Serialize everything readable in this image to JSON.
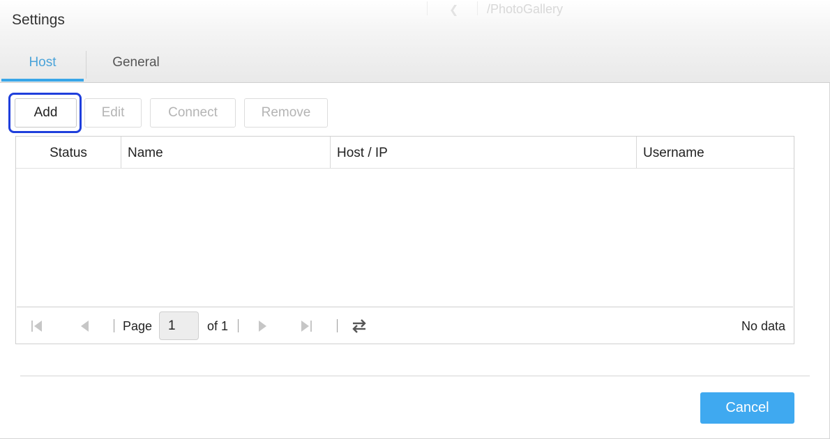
{
  "background": {
    "breadcrumb_path": "/PhotoGallery"
  },
  "dialog": {
    "title": "Settings"
  },
  "tabs": [
    {
      "label": "Host",
      "active": true
    },
    {
      "label": "General",
      "active": false
    }
  ],
  "toolbar": {
    "add_label": "Add",
    "edit_label": "Edit",
    "connect_label": "Connect",
    "remove_label": "Remove"
  },
  "table": {
    "columns": [
      "Status",
      "Name",
      "Host / IP",
      "Username"
    ],
    "rows": []
  },
  "pager": {
    "page_label": "Page",
    "current_page": "1",
    "of_label": "of 1",
    "status": "No data"
  },
  "footer": {
    "cancel_label": "Cancel"
  },
  "colors": {
    "accent": "#39a6e8",
    "primary_button": "#3fa9f0",
    "focus_outline": "#1f3fdc"
  },
  "icons": [
    "chevron-left-icon",
    "first-page-icon",
    "prev-page-icon",
    "next-page-icon",
    "last-page-icon",
    "refresh-icon"
  ]
}
